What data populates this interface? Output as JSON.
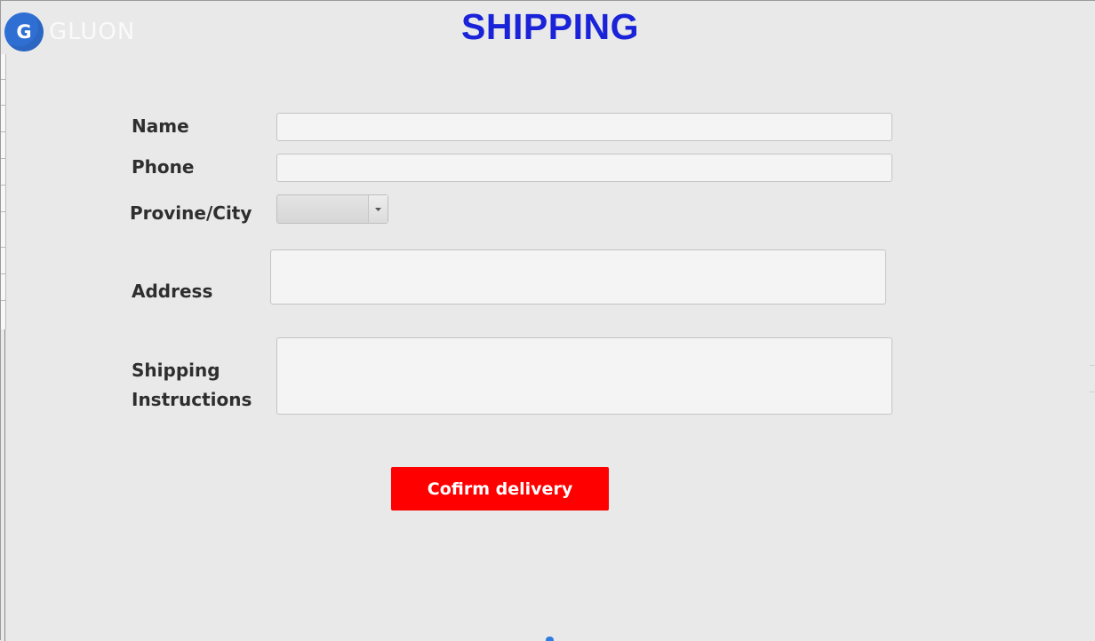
{
  "logo": {
    "badge_letter": "G",
    "brand_text": "GLUON",
    "badge_color": "#2f6fd3"
  },
  "page": {
    "title": "SHIPPING",
    "title_color": "#1a23d8"
  },
  "form": {
    "name_label": "Name",
    "name_value": "",
    "phone_label": "Phone",
    "phone_value": "",
    "province_label": "Provine/City",
    "province_selected": "",
    "address_label": "Address",
    "address_value": "",
    "instructions_label_line1": "Shipping",
    "instructions_label_line2": "Instructions",
    "instructions_value": ""
  },
  "actions": {
    "confirm_label": "Cofirm delivery",
    "confirm_color": "#ff0000"
  },
  "icons": {
    "dropdown": "chevron-down-icon"
  }
}
